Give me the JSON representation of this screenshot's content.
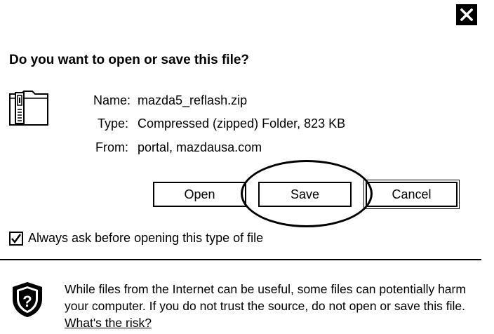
{
  "dialog": {
    "title": "Do you want to open or save this file?",
    "close_icon": "close-icon"
  },
  "file": {
    "icon": "zip-folder-icon",
    "name_label": "Name:",
    "name_value": "mazda5_reflash.zip",
    "type_label": "Type:",
    "type_value": "Compressed (zipped) Folder, 823 KB",
    "from_label": "From:",
    "from_value": "portal, mazdausa.com"
  },
  "buttons": {
    "open": "Open",
    "save": "Save",
    "cancel": "Cancel"
  },
  "checkbox": {
    "label": "Always ask before opening this type of file",
    "checked": true
  },
  "warning": {
    "icon": "shield-question-icon",
    "text": "While files from the Internet can be useful, some files can potentially harm your computer. If you do not trust the source, do not open or save this file.",
    "link_text": "What's the risk?"
  },
  "annotation": {
    "highlight": "hand-drawn circle around Save button"
  }
}
